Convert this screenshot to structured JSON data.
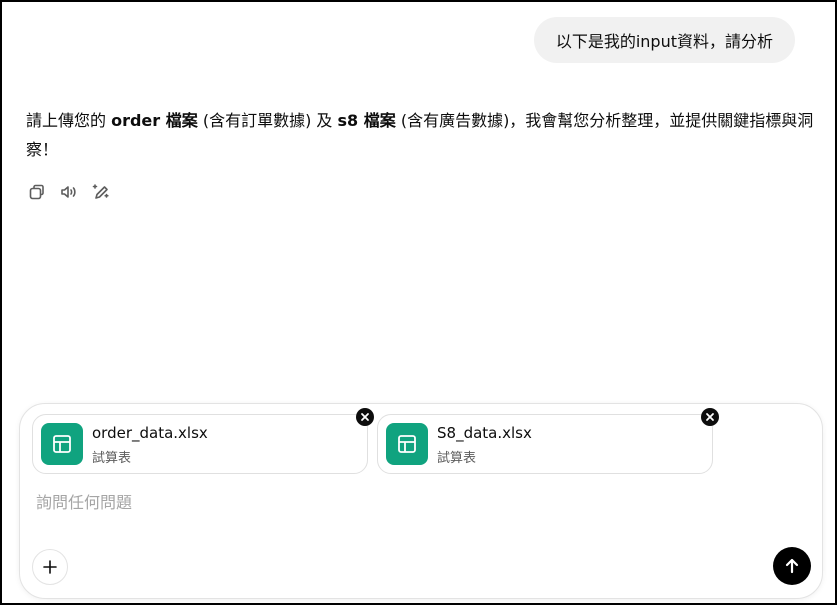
{
  "user_message": "以下是我的input資料，請分析",
  "assistant": {
    "segments": [
      {
        "text": "請上傳您的 ",
        "bold": false
      },
      {
        "text": "order 檔案",
        "bold": true
      },
      {
        "text": " (含有訂單數據) 及 ",
        "bold": false
      },
      {
        "text": "s8 檔案",
        "bold": true
      },
      {
        "text": " (含有廣告數據)，我會幫您分析整理，並提供關鍵指標與洞察！",
        "bold": false
      }
    ],
    "actions": [
      {
        "name": "copy-button",
        "icon": "copy-icon"
      },
      {
        "name": "read-aloud-button",
        "icon": "speaker-icon"
      },
      {
        "name": "edit-in-canvas-button",
        "icon": "pencil-sparkle-icon"
      }
    ]
  },
  "composer": {
    "attachments": [
      {
        "file_name": "order_data.xlsx",
        "file_type": "試算表",
        "icon": "spreadsheet-icon"
      },
      {
        "file_name": "S8_data.xlsx",
        "file_type": "試算表",
        "icon": "spreadsheet-icon"
      }
    ],
    "placeholder": "詢問任何問題",
    "value": ""
  },
  "colors": {
    "user_bubble": "#f1f1f1",
    "spreadsheet_icon_bg": "#10a37f",
    "send_button": "#000000",
    "placeholder": "#a5a5a5"
  }
}
